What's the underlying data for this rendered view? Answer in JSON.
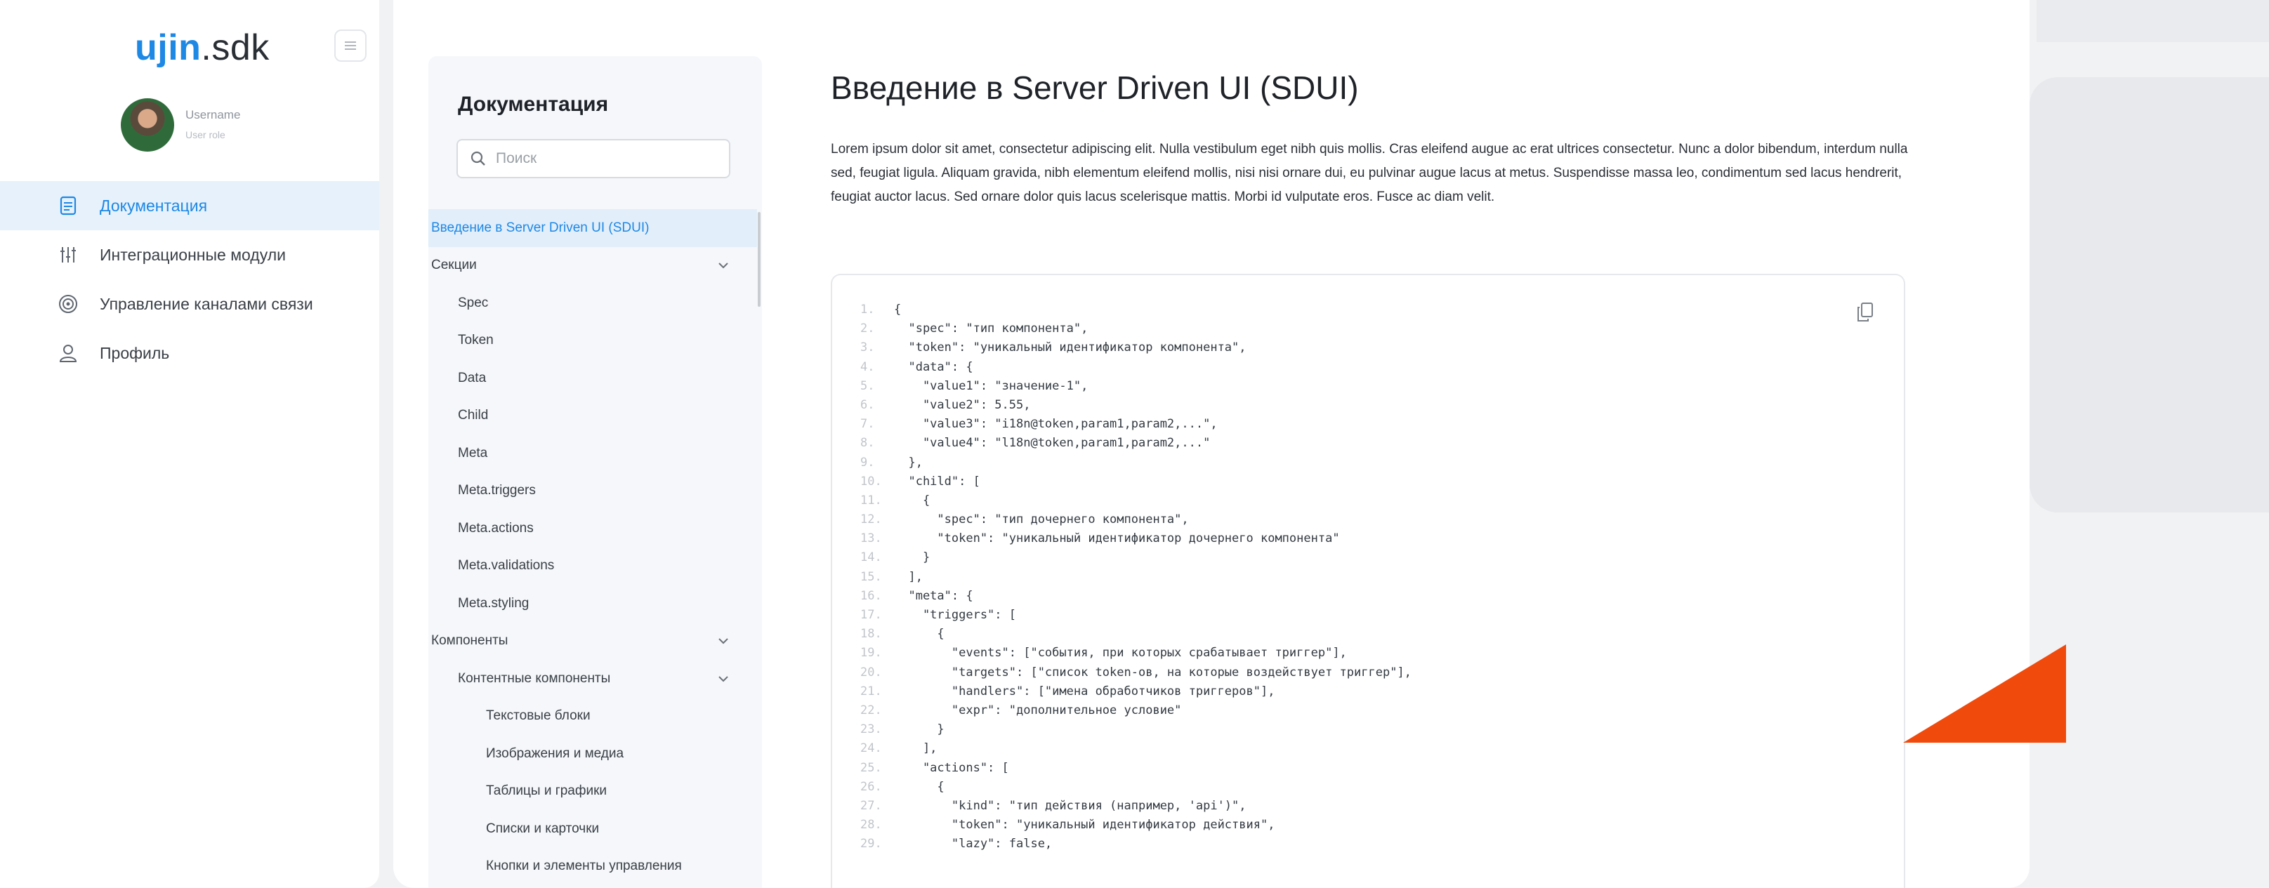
{
  "brand": {
    "name": "ujin",
    "suffix": ".sdk"
  },
  "user": {
    "name": "Username",
    "role": "User role"
  },
  "nav": [
    {
      "label": "Документация",
      "icon": "document-icon",
      "active": true
    },
    {
      "label": "Интеграционные модули",
      "icon": "sliders-icon",
      "active": false
    },
    {
      "label": "Управление каналами связи",
      "icon": "channels-icon",
      "active": false
    },
    {
      "label": "Профиль",
      "icon": "user-icon",
      "active": false
    }
  ],
  "docs": {
    "title": "Документация",
    "search_placeholder": "Поиск",
    "tree": [
      {
        "label": "Введение в Server Driven UI (SDUI)",
        "level": 0,
        "active": true
      },
      {
        "label": "Секции",
        "level": 0,
        "chevron": true
      },
      {
        "label": "Spec",
        "level": 1
      },
      {
        "label": "Token",
        "level": 1
      },
      {
        "label": "Data",
        "level": 1
      },
      {
        "label": "Child",
        "level": 1
      },
      {
        "label": "Meta",
        "level": 1
      },
      {
        "label": "Meta.triggers",
        "level": 1
      },
      {
        "label": "Meta.actions",
        "level": 1
      },
      {
        "label": "Meta.validations",
        "level": 1
      },
      {
        "label": "Meta.styling",
        "level": 1
      },
      {
        "label": "Компоненты",
        "level": 0,
        "chevron": true
      },
      {
        "label": "Контентные компоненты",
        "level": 1,
        "chevron": true
      },
      {
        "label": "Текстовые блоки",
        "level": 2
      },
      {
        "label": "Изображения и медиа",
        "level": 2
      },
      {
        "label": "Таблицы и графики",
        "level": 2
      },
      {
        "label": "Списки и карточки",
        "level": 2
      },
      {
        "label": "Кнопки и элементы управления",
        "level": 2
      }
    ]
  },
  "article": {
    "title": "Введение в Server Driven UI (SDUI)",
    "intro": "Lorem ipsum dolor sit amet, consectetur adipiscing elit. Nulla vestibulum eget nibh quis mollis. Cras eleifend augue ac erat ultrices consectetur. Nunc a dolor bibendum, interdum nulla sed, feugiat ligula. Aliquam gravida, nibh elementum eleifend mollis, nisi nisi ornare dui, eu pulvinar augue lacus at metus. Suspendisse massa leo, condimentum sed lacus hendrerit, feugiat auctor lacus. Sed ornare dolor quis lacus scelerisque mattis. Morbi id vulputate eros. Fusce ac diam velit.",
    "code_lines": [
      {
        "n": "1.",
        "t": "{"
      },
      {
        "n": "2.",
        "t": "  \"spec\": \"тип компонента\","
      },
      {
        "n": "3.",
        "t": "  \"token\": \"уникальный идентификатор компонента\","
      },
      {
        "n": "4.",
        "t": "  \"data\": {"
      },
      {
        "n": "5.",
        "t": "    \"value1\": \"значение-1\","
      },
      {
        "n": "6.",
        "t": "    \"value2\": 5.55,"
      },
      {
        "n": "7.",
        "t": "    \"value3\": \"i18n@token,param1,param2,...\","
      },
      {
        "n": "8.",
        "t": "    \"value4\": \"l18n@token,param1,param2,...\""
      },
      {
        "n": "9.",
        "t": "  },"
      },
      {
        "n": "10.",
        "t": "  \"child\": ["
      },
      {
        "n": "11.",
        "t": "    {"
      },
      {
        "n": "12.",
        "t": "      \"spec\": \"тип дочернего компонента\","
      },
      {
        "n": "13.",
        "t": "      \"token\": \"уникальный идентификатор дочернего компонента\""
      },
      {
        "n": "14.",
        "t": "    }"
      },
      {
        "n": "15.",
        "t": "  ],"
      },
      {
        "n": "16.",
        "t": "  \"meta\": {"
      },
      {
        "n": "17.",
        "t": "    \"triggers\": ["
      },
      {
        "n": "18.",
        "t": "      {"
      },
      {
        "n": "19.",
        "t": "        \"events\": [\"события, при которых срабатывает триггер\"],"
      },
      {
        "n": "20.",
        "t": "        \"targets\": [\"список token-ов, на которые воздействует триггер\"],"
      },
      {
        "n": "21.",
        "t": "        \"handlers\": [\"имена обработчиков триггеров\"],"
      },
      {
        "n": "22.",
        "t": "        \"expr\": \"дополнительное условие\""
      },
      {
        "n": "23.",
        "t": "      }"
      },
      {
        "n": "24.",
        "t": "    ],"
      },
      {
        "n": "25.",
        "t": "    \"actions\": ["
      },
      {
        "n": "26.",
        "t": "      {"
      },
      {
        "n": "27.",
        "t": "        \"kind\": \"тип действия (например, 'api')\","
      },
      {
        "n": "28.",
        "t": "        \"token\": \"уникальный идентификатор действия\","
      },
      {
        "n": "29.",
        "t": "        \"lazy\": false,"
      }
    ]
  },
  "colors": {
    "accent": "#1e88e5",
    "decor_orange": "#f04a0d"
  }
}
